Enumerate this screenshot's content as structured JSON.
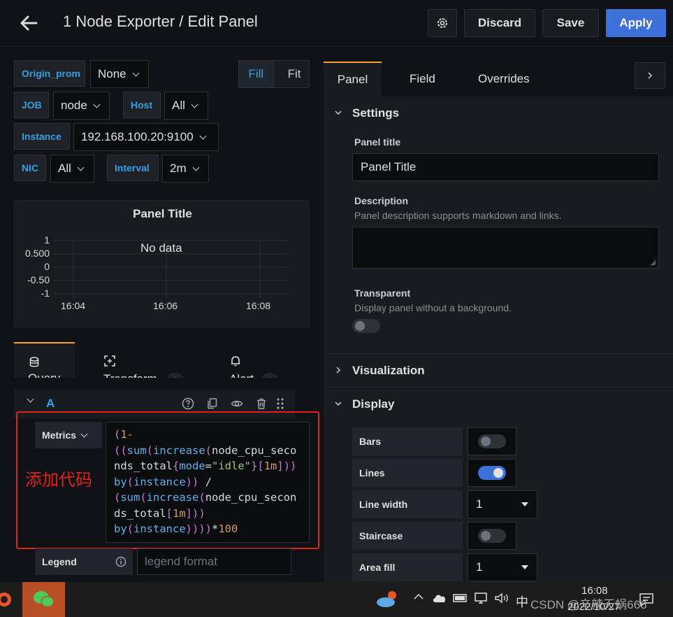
{
  "header": {
    "title": "1 Node Exporter / Edit Panel",
    "discard_label": "Discard",
    "save_label": "Save",
    "apply_label": "Apply",
    "accent_color": "#3d71d9"
  },
  "variables": [
    {
      "label": "Origin_prom",
      "value": "None"
    },
    {
      "label": "JOB",
      "value": "node"
    },
    {
      "label": "Host",
      "value": "All"
    },
    {
      "label": "Instance",
      "value": "192.168.100.20:9100"
    },
    {
      "label": "NIC",
      "value": "All"
    },
    {
      "label": "Interval",
      "value": "2m"
    }
  ],
  "view_mode": {
    "fill": "Fill",
    "fit": "Fit"
  },
  "preview": {
    "title": "Panel Title",
    "no_data": "No data",
    "y_ticks": [
      "1",
      "0.500",
      "0",
      "-0.50",
      "-1"
    ],
    "x_ticks": [
      "16:04",
      "16:06",
      "16:08"
    ]
  },
  "query_tabs": [
    {
      "label": "Query",
      "count": null
    },
    {
      "label": "Transform",
      "count": "0"
    },
    {
      "label": "Alert",
      "count": "0"
    }
  ],
  "query": {
    "ref_id": "A",
    "metrics_label": "Metrics",
    "code_lines": [
      "(1-",
      "((sum(increase(node_cpu_seco",
      "nds_total{mode=\"idle\"}[1m]))",
      "by(instance)) /",
      "(sum(increase(node_cpu_secon",
      "ds_total[1m]))",
      "by(instance))))*100"
    ],
    "annotation": "添加代码",
    "legend_label": "Legend",
    "legend_placeholder": "legend format"
  },
  "options": {
    "tabs": [
      "Panel",
      "Field",
      "Overrides"
    ],
    "settings": {
      "header": "Settings",
      "panel_title_label": "Panel title",
      "panel_title_value": "Panel Title",
      "description_label": "Description",
      "description_hint": "Panel description supports markdown and links.",
      "transparent_label": "Transparent",
      "transparent_hint": "Display panel without a background."
    },
    "visualization_header": "Visualization",
    "display": {
      "header": "Display",
      "bars_label": "Bars",
      "lines_label": "Lines",
      "line_width_label": "Line width",
      "line_width_value": "1",
      "staircase_label": "Staircase",
      "area_fill_label": "Area fill",
      "area_fill_value": "1"
    }
  },
  "taskbar": {
    "time": "16:08",
    "date": "2022/10/27",
    "ime": "中",
    "watermark": "CSDN @辛辣天蜗666"
  }
}
